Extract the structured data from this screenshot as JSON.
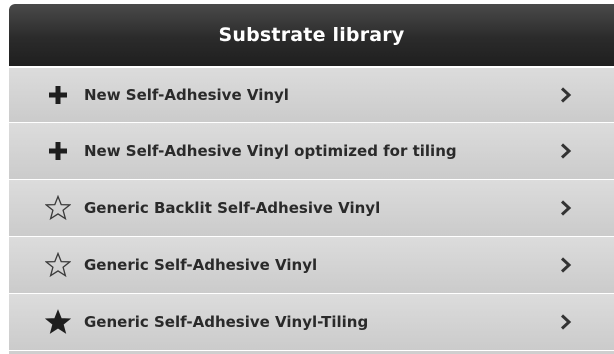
{
  "header": {
    "title": "Substrate library"
  },
  "items": [
    {
      "label": "New Self-Adhesive Vinyl",
      "icon": "plus-icon"
    },
    {
      "label": "New Self-Adhesive Vinyl optimized for tiling",
      "icon": "plus-icon"
    },
    {
      "label": "Generic Backlit Self-Adhesive Vinyl",
      "icon": "star-outline-icon"
    },
    {
      "label": "Generic Self-Adhesive Vinyl",
      "icon": "star-outline-icon"
    },
    {
      "label": "Generic Self-Adhesive Vinyl-Tiling",
      "icon": "star-filled-icon"
    }
  ],
  "colors": {
    "header_bg": "#2b2b2b",
    "row_bg": "#cfcfcf",
    "text": "#2a2a2a"
  }
}
